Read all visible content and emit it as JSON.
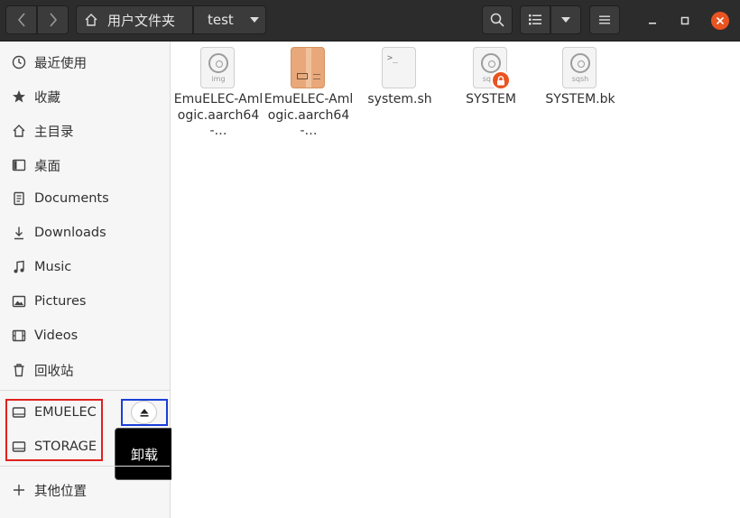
{
  "header": {
    "breadcrumb_home": "用户文件夹",
    "breadcrumb_current": "test"
  },
  "sidebar": {
    "items": [
      {
        "label": "最近使用",
        "icon": "clock-icon"
      },
      {
        "label": "收藏",
        "icon": "star-icon"
      },
      {
        "label": "主目录",
        "icon": "home-icon"
      },
      {
        "label": "桌面",
        "icon": "desktop-icon"
      },
      {
        "label": "Documents",
        "icon": "document-icon"
      },
      {
        "label": "Downloads",
        "icon": "download-icon"
      },
      {
        "label": "Music",
        "icon": "music-icon"
      },
      {
        "label": "Pictures",
        "icon": "picture-icon"
      },
      {
        "label": "Videos",
        "icon": "video-icon"
      },
      {
        "label": "回收站",
        "icon": "trash-icon"
      }
    ],
    "devices": [
      {
        "label": "EMUELEC",
        "icon": "drive-icon"
      },
      {
        "label": "STORAGE",
        "icon": "drive-icon"
      }
    ],
    "other_locations": "其他位置",
    "eject_tooltip": "卸载"
  },
  "files": [
    {
      "name": "EmuELEC-Amlogic.aarch64-…",
      "type": "disc-image",
      "sub": "img"
    },
    {
      "name": "EmuELEC-Amlogic.aarch64-…",
      "type": "archive"
    },
    {
      "name": "system.sh",
      "type": "script",
      "sub": ">_"
    },
    {
      "name": "SYSTEM",
      "type": "disc-image-locked",
      "sub": "sqsh"
    },
    {
      "name": "SYSTEM.bk",
      "type": "disc-image",
      "sub": "sqsh"
    }
  ],
  "colors": {
    "headerbar": "#2c2c2c",
    "accent": "#e95420",
    "annotation_red": "#e02020",
    "annotation_blue": "#1a3fd8"
  }
}
